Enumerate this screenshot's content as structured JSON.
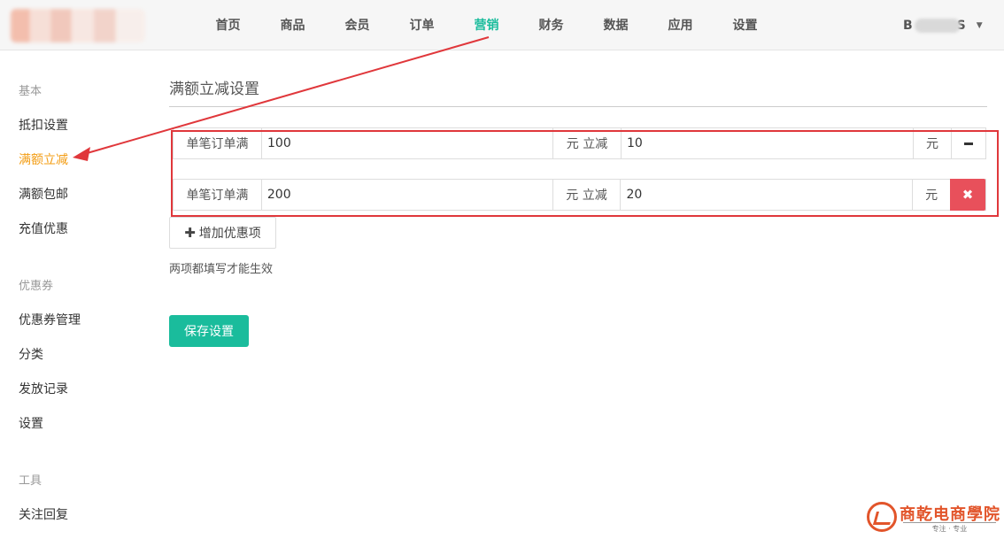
{
  "nav": {
    "items": [
      {
        "label": "首页"
      },
      {
        "label": "商品"
      },
      {
        "label": "会员"
      },
      {
        "label": "订单"
      },
      {
        "label": "营销",
        "active": true
      },
      {
        "label": "财务"
      },
      {
        "label": "数据"
      },
      {
        "label": "应用"
      },
      {
        "label": "设置"
      }
    ],
    "user_initial": "B",
    "user_suffix": "S"
  },
  "sidebar": {
    "groups": [
      {
        "title": "基本",
        "items": [
          "抵扣设置",
          "满额立减",
          "满额包邮",
          "充值优惠"
        ]
      },
      {
        "title": "优惠券",
        "items": [
          "优惠券管理",
          "分类",
          "发放记录",
          "设置"
        ]
      },
      {
        "title": "工具",
        "items": [
          "关注回复"
        ]
      }
    ],
    "active_item": "满额立减"
  },
  "main": {
    "title": "满额立减设置",
    "rows": [
      {
        "label_threshold": "单笔订单满",
        "threshold": "100",
        "label_discount": "元 立减",
        "discount": "10",
        "unit": "元"
      },
      {
        "label_threshold": "单笔订单满",
        "threshold": "200",
        "label_discount": "元 立减",
        "discount": "20",
        "unit": "元"
      }
    ],
    "add_button": "增加优惠项",
    "hint": "两项都填写才能生效",
    "save_button": "保存设置"
  },
  "colors": {
    "accent": "#1abc9c",
    "active_sidebar": "#f39c12",
    "danger": "#e8505b",
    "annotation": "#e0373b"
  },
  "watermark": {
    "title": "商乾电商學院",
    "subtitle": "专注 · 专业"
  }
}
